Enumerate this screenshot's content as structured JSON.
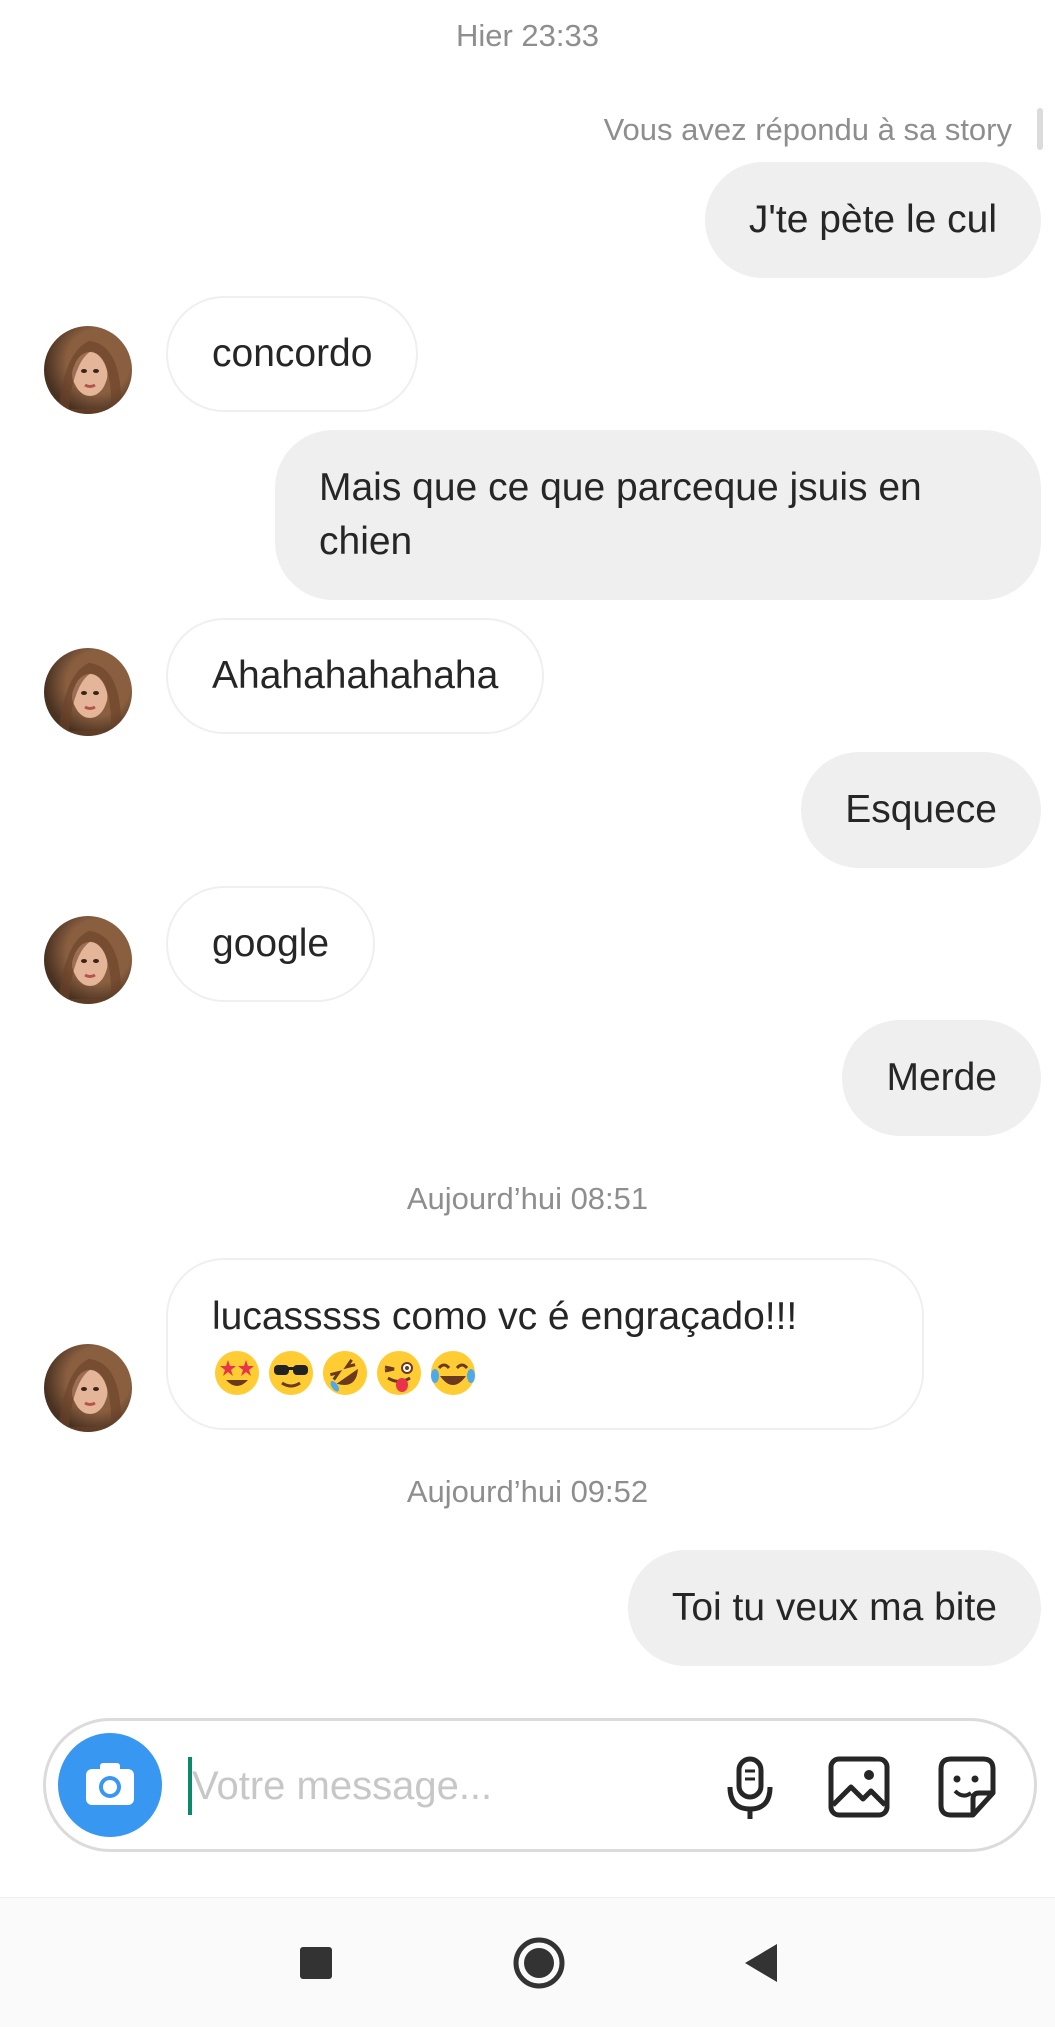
{
  "timestamps": {
    "t1": "Hier 23:33",
    "t2": "Aujourd’hui 08:51",
    "t3": "Aujourd’hui 09:52"
  },
  "story_reply_note": "Vous avez répondu à sa story",
  "messages": [
    {
      "from": "me",
      "text": "J'te pète le cul"
    },
    {
      "from": "them",
      "text": "concordo"
    },
    {
      "from": "me",
      "text": "Mais que ce que parceque jsuis en chien"
    },
    {
      "from": "them",
      "text": "Ahahahahahaha"
    },
    {
      "from": "me",
      "text": "Esquece"
    },
    {
      "from": "them",
      "text": "google"
    },
    {
      "from": "me",
      "text": "Merde"
    },
    {
      "from": "them",
      "text": "lucasssss como vc é engraçado!!!",
      "emojis": [
        "star-struck",
        "smiling-face-with-sunglasses",
        "rolling-on-the-floor-laughing",
        "winking-face-with-tongue",
        "face-with-tears-of-joy"
      ]
    },
    {
      "from": "me",
      "text": "Toi tu veux ma bite"
    }
  ],
  "composer": {
    "placeholder": "Votre message..."
  },
  "icons": {
    "camera": "camera-icon",
    "mic": "microphone-icon",
    "gallery": "image-icon",
    "sticker": "sticker-icon",
    "nav": [
      "square-recents-icon",
      "circle-home-icon",
      "triangle-back-icon"
    ]
  },
  "colors": {
    "accent": "#3897f0",
    "out_bubble": "#efefef",
    "meta_text": "#8e8e8e"
  }
}
